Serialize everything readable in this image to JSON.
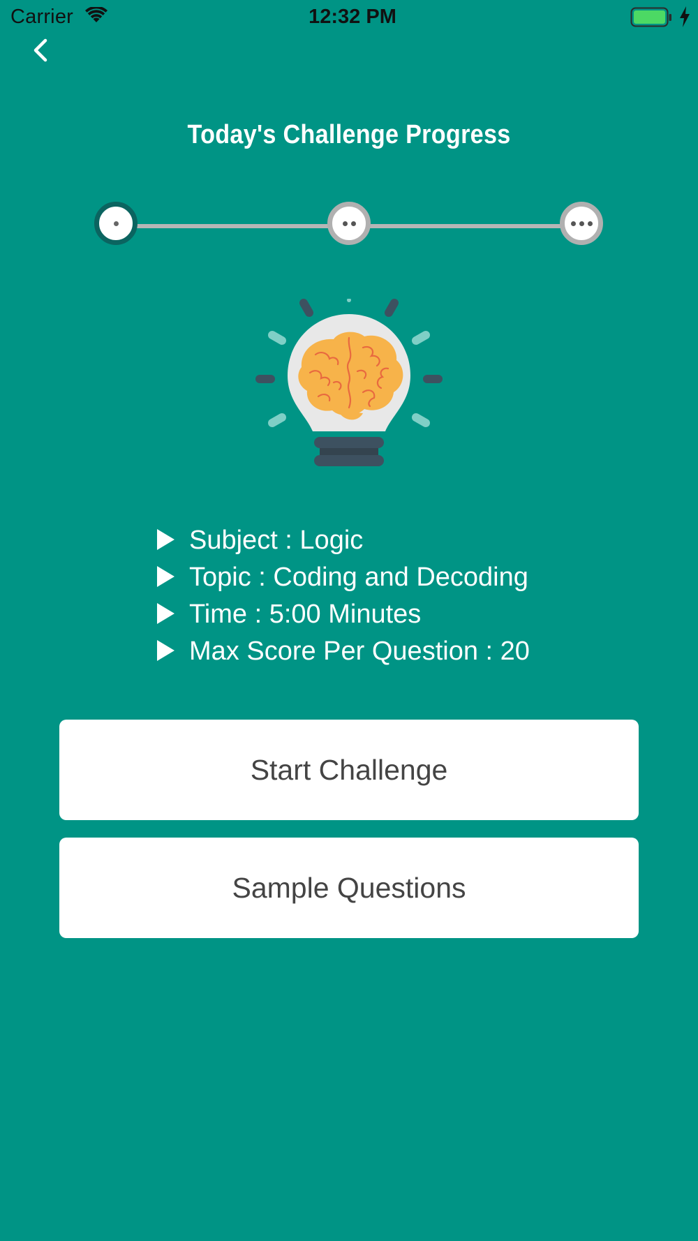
{
  "status_bar": {
    "carrier": "Carrier",
    "time": "12:32 PM",
    "battery_color": "#4cd964"
  },
  "nav": {
    "back_icon": "chevron-left-icon"
  },
  "page": {
    "title": "Today's Challenge Progress",
    "background_color": "#009485"
  },
  "progress": {
    "steps": [
      {
        "dots": 1,
        "state": "active"
      },
      {
        "dots": 2,
        "state": "inactive"
      },
      {
        "dots": 3,
        "state": "inactive"
      }
    ],
    "active_color": "#0b6460",
    "inactive_color": "#b0b0b0"
  },
  "illustration": {
    "icon": "lightbulb-brain-icon"
  },
  "info": {
    "items": [
      {
        "label": "Subject : Logic"
      },
      {
        "label": "Topic : Coding and Decoding"
      },
      {
        "label": "Time : 5:00 Minutes"
      },
      {
        "label": "Max Score Per Question : 20"
      }
    ]
  },
  "actions": {
    "start_label": "Start Challenge",
    "sample_label": "Sample Questions"
  }
}
